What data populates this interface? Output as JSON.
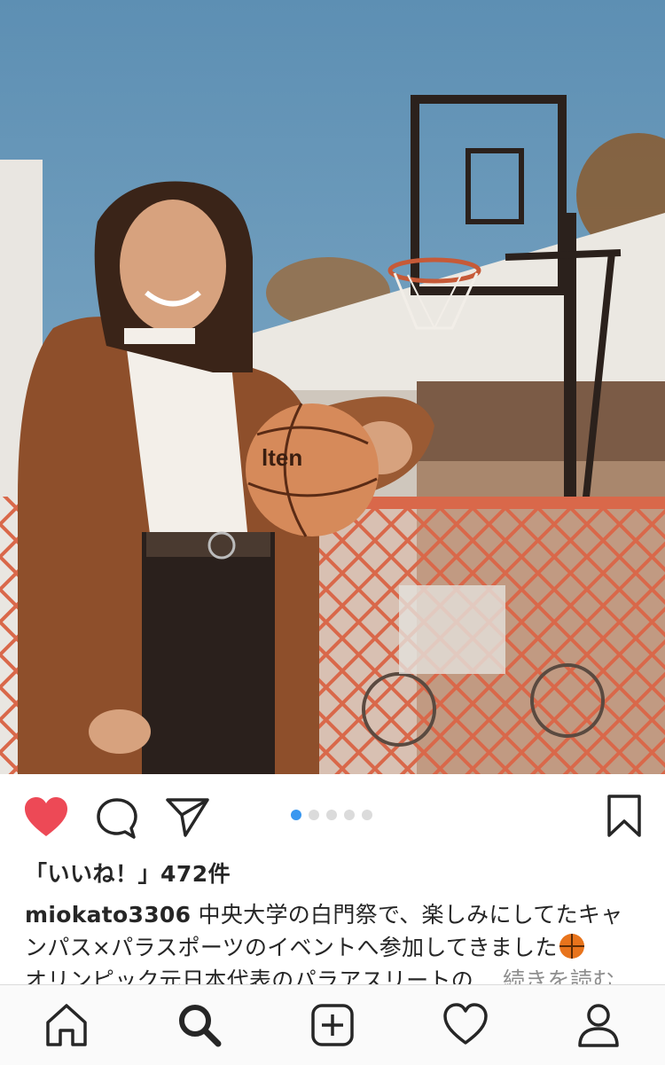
{
  "photo": {
    "description_icon": "post-photo"
  },
  "actions": {
    "like_icon": "heart-filled-icon",
    "comment_icon": "comment-icon",
    "share_icon": "direct-share-icon",
    "save_icon": "bookmark-icon",
    "carousel_count": 5,
    "carousel_active": 1,
    "like_color": "#ed4956",
    "dot_active_color": "#3897f0"
  },
  "post": {
    "likes_text": "「いいね！」472件",
    "username": "miokato3306",
    "caption_line1": "中央大学の白門祭で、楽しみにしてたキャンパス×パラスポーツのイベントへ参加してきました",
    "caption_line2": "オリンピック元日本代表のパラアスリートの...",
    "more_label": "続きを読む"
  },
  "tabbar": {
    "items": [
      "home-icon",
      "search-icon",
      "new-post-icon",
      "activity-heart-icon",
      "profile-icon"
    ]
  }
}
